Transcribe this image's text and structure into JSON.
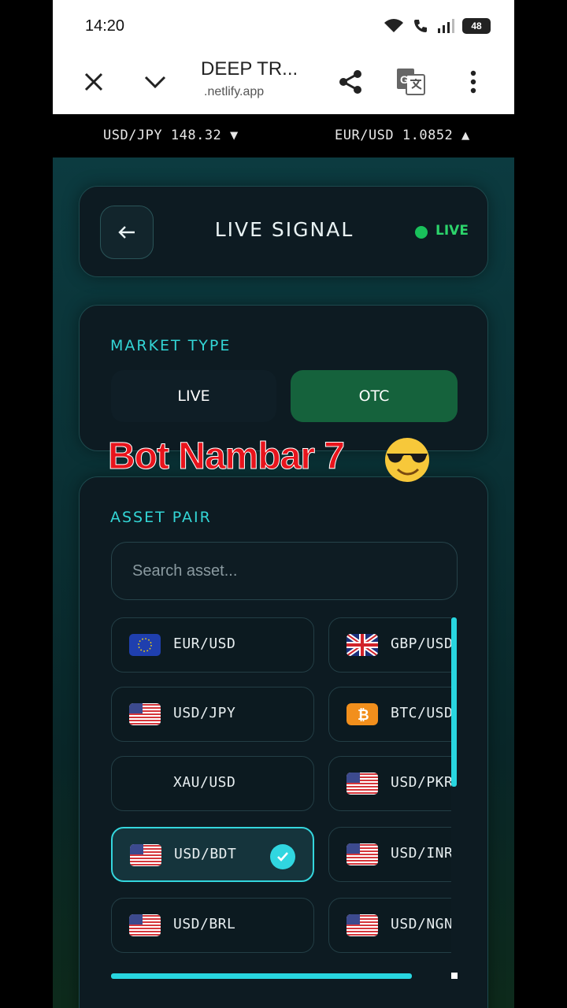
{
  "status_bar": {
    "time": "14:20",
    "battery": "48",
    "icons": [
      "wifi-icon",
      "wifi-call-icon",
      "signal-icon",
      "battery-icon"
    ]
  },
  "browser": {
    "title": "DEEP TR...",
    "url": ".netlify.app",
    "icons": [
      "close-icon",
      "chevron-down-icon",
      "share-icon",
      "translate-icon",
      "more-vert-icon"
    ]
  },
  "ticker": {
    "items": [
      {
        "text": "USD/JPY 148.32 ▼"
      },
      {
        "text": "EUR/USD 1.0852 ▲"
      }
    ]
  },
  "header": {
    "title": "LIVE SIGNAL",
    "live_label": "LIVE",
    "back_icon": "arrow-left-icon"
  },
  "market": {
    "label": "MARKET TYPE",
    "options": [
      {
        "label": "LIVE",
        "selected": false
      },
      {
        "label": "OTC",
        "selected": true
      }
    ]
  },
  "overlay": {
    "text": "Bot Nambar 7",
    "emoji": "sunglasses-emoji-icon"
  },
  "assets": {
    "label": "ASSET PAIR",
    "search_placeholder": "Search asset...",
    "pairs": [
      {
        "label": "EUR/USD",
        "flag": "eu-flag-icon",
        "selected": false
      },
      {
        "label": "GBP/USD",
        "flag": "uk-flag-icon",
        "selected": false
      },
      {
        "label": "USD/JPY",
        "flag": "us-flag-icon",
        "selected": false
      },
      {
        "label": "BTC/USD",
        "flag": "bitcoin-icon",
        "selected": false
      },
      {
        "label": "XAU/USD",
        "flag": "",
        "selected": false
      },
      {
        "label": "USD/PKR",
        "flag": "us-flag-icon",
        "selected": false
      },
      {
        "label": "USD/BDT",
        "flag": "us-flag-icon",
        "selected": true
      },
      {
        "label": "USD/INR",
        "flag": "us-flag-icon",
        "selected": false
      },
      {
        "label": "USD/BRL",
        "flag": "us-flag-icon",
        "selected": false
      },
      {
        "label": "USD/NGN",
        "flag": "us-flag-icon",
        "selected": false
      }
    ]
  },
  "colors": {
    "accent": "#33d6d6",
    "otc_green": "#15623c",
    "live_green": "#2cd46b",
    "overlay_red": "#e8141c"
  }
}
